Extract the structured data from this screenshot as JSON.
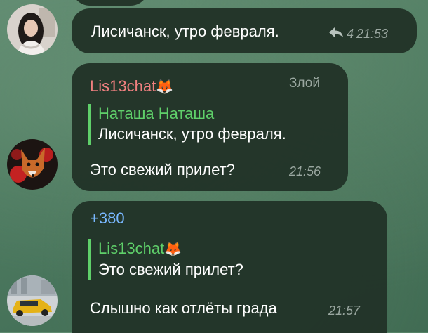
{
  "messages": [
    {
      "text": "Лисичанск, утро февраля.",
      "reply_count": "4",
      "time": "21:53"
    },
    {
      "sender": "Lis13chat",
      "sender_emoji": "🦊",
      "role": "Злой",
      "quote": {
        "name": "Наташа Наташа",
        "text": "Лисичанск, утро февраля."
      },
      "text": "Это свежий прилет?",
      "time": "21:56"
    },
    {
      "sender": "+380",
      "quote": {
        "name": "Lis13chat",
        "emoji": "🦊",
        "text": "Это свежий прилет?"
      },
      "text": "Слышно как отлёты града",
      "time": "21:57"
    }
  ],
  "colors": {
    "bubble": "#223428",
    "sender1": "#f08080",
    "sender2": "#79b8ff",
    "quote_accent": "#5fd06a",
    "meta": "#9aa7a0"
  },
  "icons": {
    "reply": "reply-arrow-icon"
  }
}
